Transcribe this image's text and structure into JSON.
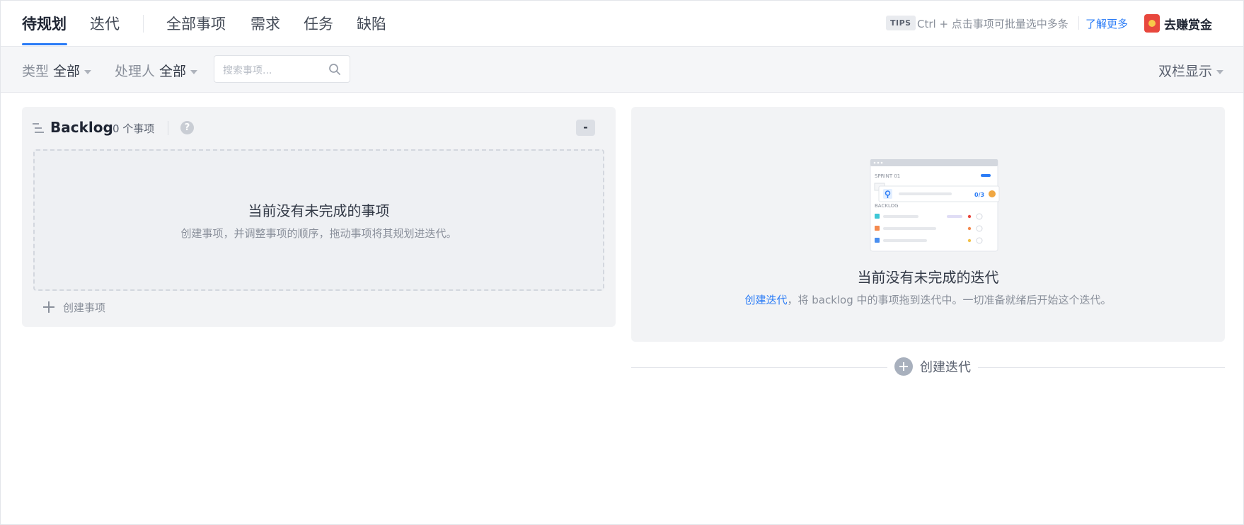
{
  "tabs": [
    {
      "label": "待规划",
      "active": true
    },
    {
      "label": "迭代",
      "active": false
    },
    {
      "label": "全部事项",
      "active": false
    },
    {
      "label": "需求",
      "active": false
    },
    {
      "label": "任务",
      "active": false
    },
    {
      "label": "缺陷",
      "active": false
    }
  ],
  "tips": {
    "badge": "TIPS",
    "text": "Ctrl + 点击事项可批量选中多条",
    "link": "了解更多"
  },
  "reward": {
    "label": "去赚赏金",
    "icon": "red-envelope-icon"
  },
  "filters": {
    "type": {
      "label": "类型",
      "value": "全部"
    },
    "assignee": {
      "label": "处理人",
      "value": "全部"
    },
    "search_placeholder": "搜索事项...",
    "display_mode": "双栏显示"
  },
  "backlog": {
    "title": "Backlog",
    "count_text": "0 个事项",
    "collapse_label": "-",
    "empty_title": "当前没有未完成的事项",
    "empty_desc": "创建事项，并调整事项的顺序，拖动事项将其规划进迭代。",
    "create_label": "创建事项"
  },
  "sprint": {
    "illustration": {
      "sprint_label": "SPRINT 01",
      "backlog_label": "BACKLOG",
      "progress": "0/3"
    },
    "empty_title": "当前没有未完成的迭代",
    "desc_link": "创建迭代",
    "desc_rest": "，将 backlog 中的事项拖到迭代中。一切准备就绪后开始这个迭代。",
    "create_label": "创建迭代"
  },
  "colors": {
    "accent": "#2b7cf6",
    "panel_bg": "#f2f3f5",
    "text_primary": "#1f2533",
    "text_muted": "#8a909b"
  }
}
